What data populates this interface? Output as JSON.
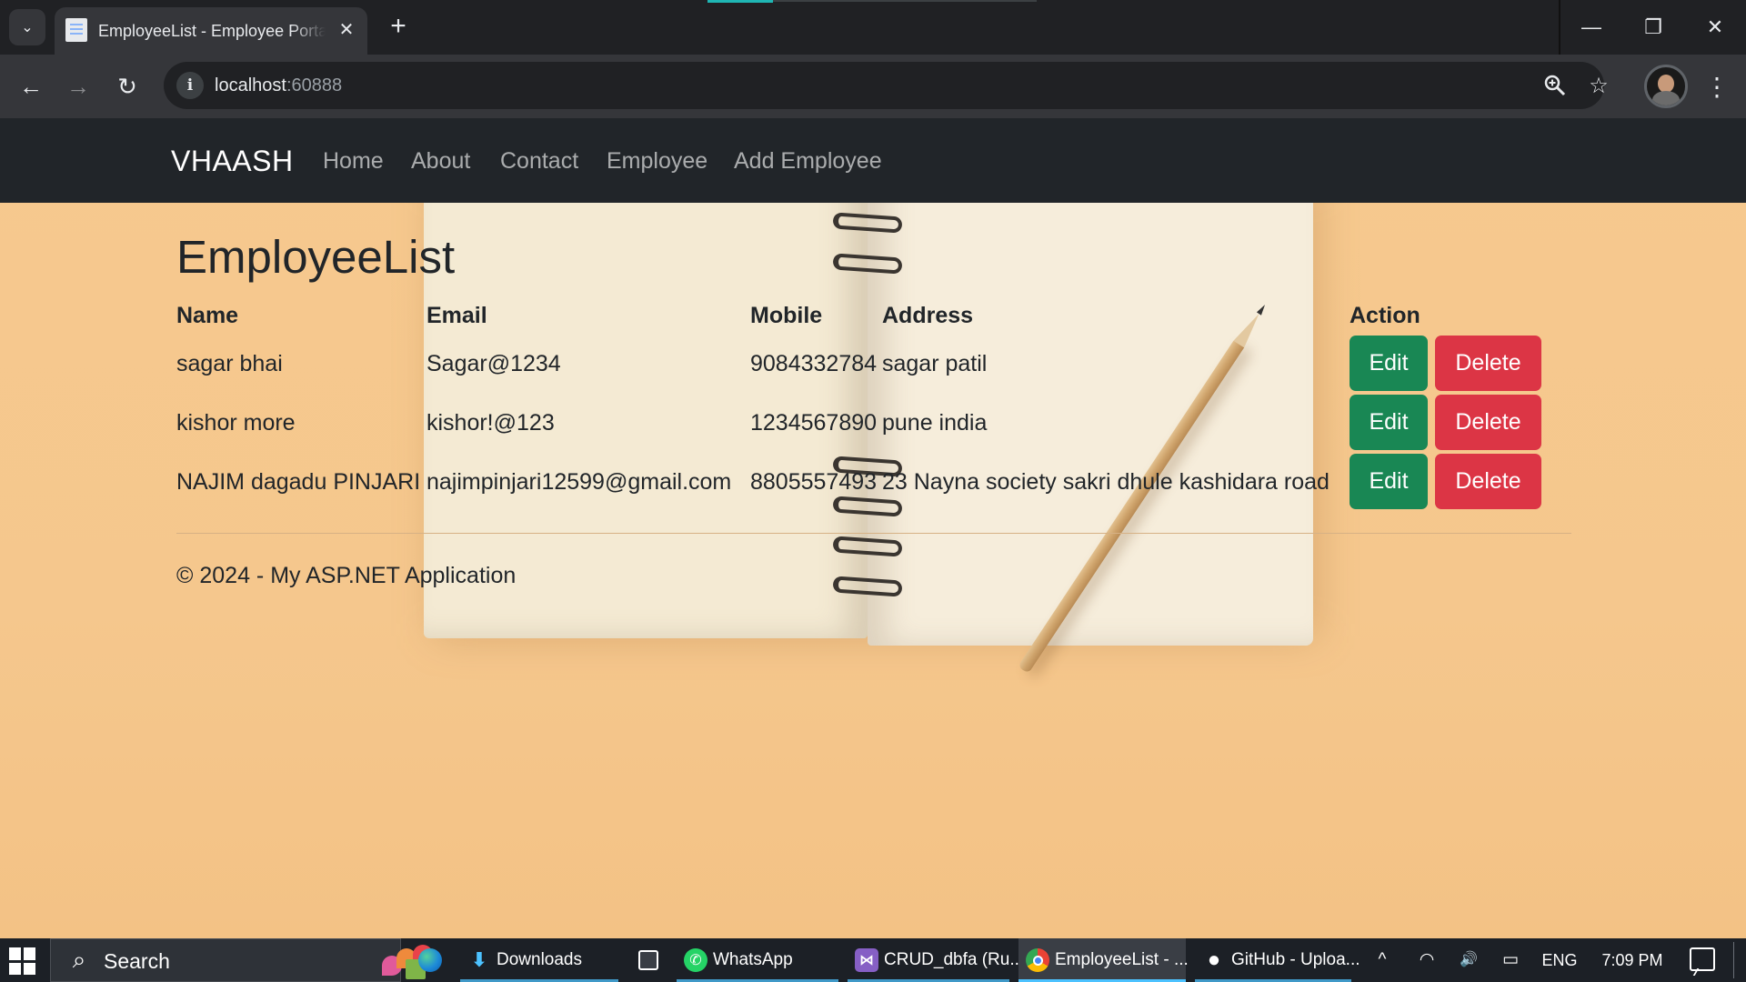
{
  "browser": {
    "tab_title": "EmployeeList - Employee Portal",
    "url_host": "localhost",
    "url_port": ":60888",
    "icons": [
      "tab-search-dropdown-icon",
      "page-favicon-icon",
      "close-icon",
      "new-tab-icon",
      "back-icon",
      "forward-icon",
      "reload-icon",
      "site-info-icon",
      "zoom-icon",
      "star-icon",
      "profile-avatar",
      "more-menu-icon",
      "minimize-icon",
      "restore-icon",
      "window-close-icon"
    ],
    "glyphs": {
      "dropdown": "⌄",
      "tab_close": "✕",
      "new_tab": "+",
      "back": "←",
      "forward": "→",
      "reload": "↻",
      "info": "i",
      "zoom": "🔍",
      "star": "☆",
      "more": "⋮",
      "minimize": "—",
      "restore": "❐",
      "close": "✕"
    }
  },
  "site": {
    "brand": "VHAASH",
    "nav": [
      "Home",
      "About",
      "Contact",
      "Employee",
      "Add Employee"
    ]
  },
  "main": {
    "title": "EmployeeList",
    "columns": [
      "Name",
      "Email",
      "Mobile",
      "Address",
      "Action"
    ],
    "rows": [
      {
        "name": "sagar bhai",
        "email": "Sagar@1234",
        "mobile": "9084332784",
        "address": "sagar patil",
        "edit": "Edit",
        "delete": "Delete"
      },
      {
        "name": "kishor more",
        "email": "kishor!@123",
        "mobile": "1234567890",
        "address": "pune india",
        "edit": "Edit",
        "delete": "Delete"
      },
      {
        "name": "NAJIM dagadu PINJARI",
        "email": "najimpinjari12599@gmail.com",
        "mobile": "8805557493",
        "address": "23 Nayna society sakri dhule kashidara road",
        "edit": "Edit",
        "delete": "Delete"
      }
    ],
    "footer": "© 2024 - My ASP.NET Application"
  },
  "colors": {
    "navbar": "#212529",
    "edit_button": "#198754",
    "delete_button": "#dc3545",
    "page_background": "#f5c98e"
  },
  "taskbar": {
    "search_placeholder": "Search",
    "search_glyph": "⌕",
    "apps": [
      {
        "label": "Downloads",
        "icon": "downloads-icon",
        "glyph": "⬇"
      },
      {
        "label": "WhatsApp",
        "icon": "whatsapp-icon",
        "glyph": "✆"
      },
      {
        "label": "CRUD_dbfa (Ru...",
        "icon": "visual-studio-icon",
        "glyph": "⋈"
      },
      {
        "label": "EmployeeList - ...",
        "icon": "chrome-icon",
        "glyph": ""
      },
      {
        "label": "GitHub - Uploa...",
        "icon": "github-icon",
        "glyph": "●"
      }
    ],
    "pinned_icons": [
      "edge-icon",
      "store-icon"
    ],
    "tray": {
      "chevron": "^",
      "wifi": "◠",
      "volume": "🔊",
      "battery": "▭",
      "language": "ENG",
      "time": "7:09 PM"
    }
  }
}
